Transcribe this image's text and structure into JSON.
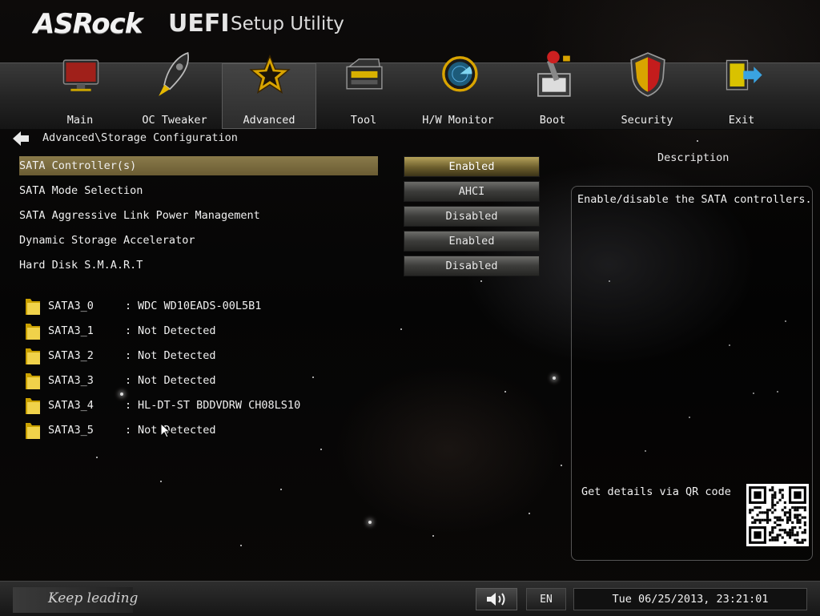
{
  "header": {
    "brand": "ASRock",
    "product": "UEFI",
    "subtitle": "Setup Utility"
  },
  "nav": {
    "active": "Advanced",
    "tabs": [
      {
        "label": "Main",
        "icon": "monitor-icon"
      },
      {
        "label": "OC Tweaker",
        "icon": "rocket-icon"
      },
      {
        "label": "Advanced",
        "icon": "star-icon"
      },
      {
        "label": "Tool",
        "icon": "toolbox-icon"
      },
      {
        "label": "H/W Monitor",
        "icon": "radar-icon"
      },
      {
        "label": "Boot",
        "icon": "joystick-icon"
      },
      {
        "label": "Security",
        "icon": "shield-icon"
      },
      {
        "label": "Exit",
        "icon": "exit-door-icon"
      }
    ]
  },
  "breadcrumb": "Advanced\\Storage Configuration",
  "settings": [
    {
      "label": "SATA Controller(s)",
      "value": "Enabled",
      "selected": true
    },
    {
      "label": "SATA Mode Selection",
      "value": "AHCI",
      "selected": false
    },
    {
      "label": "SATA Aggressive Link Power Management",
      "value": "Disabled",
      "selected": false
    },
    {
      "label": "Dynamic Storage Accelerator",
      "value": "Enabled",
      "selected": false
    },
    {
      "label": "Hard Disk S.M.A.R.T",
      "value": "Disabled",
      "selected": false
    }
  ],
  "drives": [
    {
      "port": "SATA3_0",
      "device": "WDC WD10EADS-00L5B1"
    },
    {
      "port": "SATA3_1",
      "device": "Not Detected"
    },
    {
      "port": "SATA3_2",
      "device": "Not Detected"
    },
    {
      "port": "SATA3_3",
      "device": "Not Detected"
    },
    {
      "port": "SATA3_4",
      "device": "HL-DT-ST BDDVDRW CH08LS10"
    },
    {
      "port": "SATA3_5",
      "device": "Not Detected"
    }
  ],
  "description": {
    "title": "Description",
    "text": "Enable/disable the SATA controllers.",
    "qr_label": "Get details via QR code"
  },
  "footer": {
    "slogan": "Keep leading",
    "language": "EN",
    "datetime": "Tue 06/25/2013, 23:21:01"
  },
  "colors": {
    "selected_row": "#7a6a3e",
    "selected_value": "#b5a25a",
    "value_box": "#4a4a48"
  }
}
